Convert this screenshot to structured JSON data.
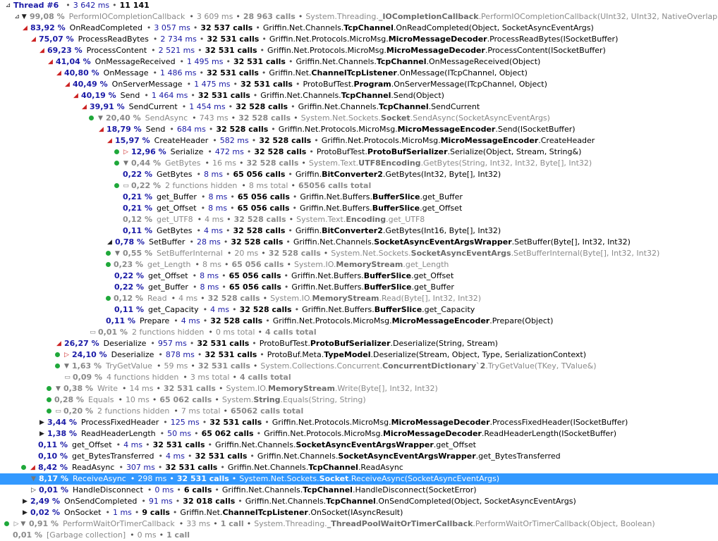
{
  "colors": {
    "selection": "#3399ff",
    "percent": "#1a1aa6",
    "dot": "#1fa83a",
    "toggle_red": "#cc2222"
  },
  "rows": [
    {
      "indent": 0,
      "dot": false,
      "toggle": "⊿",
      "tcolor": "blk",
      "pct": "Thread #6",
      "name": "",
      "ms": "3 642 ms",
      "calls": "11 141",
      "ns": "",
      "cls": "",
      "sig": "",
      "dim": false
    },
    {
      "indent": 1,
      "dot": false,
      "toggle": "⊿ ▼",
      "tcolor": "blk",
      "pct": "99,08 %",
      "name": "PerformIOCompletionCallback",
      "ms": "3 609 ms",
      "calls": "28 963 calls",
      "ns": "System.Threading.",
      "cls": "_IOCompletionCallback",
      "sig": ".PerformIOCompletionCallback(UInt32, UInt32, NativeOverlapped*)",
      "dim": true
    },
    {
      "indent": 2,
      "dot": false,
      "toggle": "◢",
      "tcolor": "red",
      "pct": "83,92 %",
      "name": "OnReadCompleted",
      "ms": "3 057 ms",
      "calls": "32 537 calls",
      "ns": "Griffin.Net.Channels.",
      "cls": "TcpChannel",
      "sig": ".OnReadCompleted(Object, SocketAsyncEventArgs)",
      "dim": false
    },
    {
      "indent": 3,
      "dot": false,
      "toggle": "◢",
      "tcolor": "red",
      "pct": "75,07 %",
      "name": "ProcessReadBytes",
      "ms": "2 734 ms",
      "calls": "32 531 calls",
      "ns": "Griffin.Net.Protocols.MicroMsg.",
      "cls": "MicroMessageDecoder",
      "sig": ".ProcessReadBytes(ISocketBuffer)",
      "dim": false
    },
    {
      "indent": 4,
      "dot": false,
      "toggle": "◢",
      "tcolor": "red",
      "pct": "69,23 %",
      "name": "ProcessContent",
      "ms": "2 521 ms",
      "calls": "32 531 calls",
      "ns": "Griffin.Net.Protocols.MicroMsg.",
      "cls": "MicroMessageDecoder",
      "sig": ".ProcessContent(ISocketBuffer)",
      "dim": false
    },
    {
      "indent": 5,
      "dot": false,
      "toggle": "◢",
      "tcolor": "red",
      "pct": "41,04 %",
      "name": "OnMessageReceived",
      "ms": "1 495 ms",
      "calls": "32 531 calls",
      "ns": "Griffin.Net.Channels.",
      "cls": "TcpChannel",
      "sig": ".OnMessageReceived(Object)",
      "dim": false
    },
    {
      "indent": 6,
      "dot": false,
      "toggle": "◢",
      "tcolor": "red",
      "pct": "40,80 %",
      "name": "OnMessage",
      "ms": "1 486 ms",
      "calls": "32 531 calls",
      "ns": "Griffin.Net.",
      "cls": "ChannelTcpListener",
      "sig": ".OnMessage(ITcpChannel, Object)",
      "dim": false
    },
    {
      "indent": 7,
      "dot": false,
      "toggle": "◢",
      "tcolor": "red",
      "pct": "40,49 %",
      "name": "OnServerMessage",
      "ms": "1 475 ms",
      "calls": "32 531 calls",
      "ns": "ProtoBufTest.",
      "cls": "Program",
      "sig": ".OnServerMessage(ITcpChannel, Object)",
      "dim": false
    },
    {
      "indent": 8,
      "dot": false,
      "toggle": "◢",
      "tcolor": "red",
      "pct": "40,19 %",
      "name": "Send",
      "ms": "1 464 ms",
      "calls": "32 531 calls",
      "ns": "Griffin.Net.Channels.",
      "cls": "TcpChannel",
      "sig": ".Send(Object)",
      "dim": false
    },
    {
      "indent": 9,
      "dot": false,
      "toggle": "◢",
      "tcolor": "red",
      "pct": "39,91 %",
      "name": "SendCurrent",
      "ms": "1 454 ms",
      "calls": "32 528 calls",
      "ns": "Griffin.Net.Channels.",
      "cls": "TcpChannel",
      "sig": ".SendCurrent",
      "dim": false
    },
    {
      "indent": 10,
      "dot": true,
      "toggle": "▼",
      "tcolor": "gray",
      "pct": "20,40 %",
      "name": "SendAsync",
      "ms": "743 ms",
      "calls": "32 528 calls",
      "ns": "System.Net.Sockets.",
      "cls": "Socket",
      "sig": ".SendAsync(SocketAsyncEventArgs)",
      "dim": true
    },
    {
      "indent": 11,
      "dot": false,
      "toggle": "◢",
      "tcolor": "red",
      "pct": "18,79 %",
      "name": "Send",
      "ms": "684 ms",
      "calls": "32 528 calls",
      "ns": "Griffin.Net.Protocols.MicroMsg.",
      "cls": "MicroMessageEncoder",
      "sig": ".Send(ISocketBuffer)",
      "dim": false
    },
    {
      "indent": 12,
      "dot": false,
      "toggle": "◢",
      "tcolor": "red",
      "pct": "15,97 %",
      "name": "CreateHeader",
      "ms": "582 ms",
      "calls": "32 528 calls",
      "ns": "Griffin.Net.Protocols.MicroMsg.",
      "cls": "MicroMessageEncoder",
      "sig": ".CreateHeader",
      "dim": false
    },
    {
      "indent": 13,
      "dot": true,
      "toggle": "▷",
      "tcolor": "red",
      "pct": "12,96 %",
      "name": "Serialize",
      "ms": "472 ms",
      "calls": "32 528 calls",
      "ns": "ProtoBufTest.",
      "cls": "ProtoBufSerializer",
      "sig": ".Serialize(Object, Stream, String&)",
      "dim": false
    },
    {
      "indent": 13,
      "dot": true,
      "toggle": "▼",
      "tcolor": "gray",
      "pct": "0,44 %",
      "name": "GetBytes",
      "ms": "16 ms",
      "calls": "32 528 calls",
      "ns": "System.Text.",
      "cls": "UTF8Encoding",
      "sig": ".GetBytes(String, Int32, Int32, Byte[], Int32)",
      "dim": true
    },
    {
      "indent": 14,
      "dot": false,
      "toggle": "",
      "tcolor": "gray",
      "pct": "0,22 %",
      "name": "GetBytes",
      "ms": "8 ms",
      "calls": "65 056 calls",
      "ns": "Griffin.",
      "cls": "BitConverter2",
      "sig": ".GetBytes(Int32, Byte[], Int32)",
      "dim": false
    },
    {
      "indent": 13,
      "dot": true,
      "toggle": "▭",
      "tcolor": "gray",
      "pct": "0,22 %",
      "name": "2 functions hidden",
      "ms": "8 ms total",
      "calls": "65056 calls total",
      "ns": "",
      "cls": "",
      "sig": "",
      "dim": true,
      "hidden": true
    },
    {
      "indent": 14,
      "dot": false,
      "toggle": "",
      "tcolor": "gray",
      "pct": "0,21 %",
      "name": "get_Buffer",
      "ms": "8 ms",
      "calls": "65 056 calls",
      "ns": "Griffin.Net.Buffers.",
      "cls": "BufferSlice",
      "sig": ".get_Buffer",
      "dim": false
    },
    {
      "indent": 14,
      "dot": false,
      "toggle": "",
      "tcolor": "gray",
      "pct": "0,21 %",
      "name": "get_Offset",
      "ms": "8 ms",
      "calls": "65 056 calls",
      "ns": "Griffin.Net.Buffers.",
      "cls": "BufferSlice",
      "sig": ".get_Offset",
      "dim": false
    },
    {
      "indent": 14,
      "dot": false,
      "toggle": "",
      "tcolor": "gray",
      "pct": "0,12 %",
      "name": "get_UTF8",
      "ms": "4 ms",
      "calls": "32 528 calls",
      "ns": "System.Text.",
      "cls": "Encoding",
      "sig": ".get_UTF8",
      "dim": true
    },
    {
      "indent": 14,
      "dot": false,
      "toggle": "",
      "tcolor": "gray",
      "pct": "0,11 %",
      "name": "GetBytes",
      "ms": "4 ms",
      "calls": "32 528 calls",
      "ns": "Griffin.",
      "cls": "BitConverter2",
      "sig": ".GetBytes(Int16, Byte[], Int32)",
      "dim": false
    },
    {
      "indent": 12,
      "dot": false,
      "toggle": "◢",
      "tcolor": "blk",
      "pct": "0,78 %",
      "name": "SetBuffer",
      "ms": "28 ms",
      "calls": "32 528 calls",
      "ns": "Griffin.Net.Channels.",
      "cls": "SocketAsyncEventArgsWrapper",
      "sig": ".SetBuffer(Byte[], Int32, Int32)",
      "dim": false
    },
    {
      "indent": 12,
      "dot": true,
      "toggle": "▼",
      "tcolor": "gray",
      "pct": "0,55 %",
      "name": "SetBufferInternal",
      "ms": "20 ms",
      "calls": "32 528 calls",
      "ns": "System.Net.Sockets.",
      "cls": "SocketAsyncEventArgs",
      "sig": ".SetBufferInternal(Byte[], Int32, Int32)",
      "dim": true
    },
    {
      "indent": 12,
      "dot": true,
      "toggle": "",
      "tcolor": "gray",
      "pct": "0,23 %",
      "name": "get_Length",
      "ms": "8 ms",
      "calls": "65 056 calls",
      "ns": "System.IO.",
      "cls": "MemoryStream",
      "sig": ".get_Length",
      "dim": true
    },
    {
      "indent": 13,
      "dot": false,
      "toggle": "",
      "tcolor": "gray",
      "pct": "0,22 %",
      "name": "get_Offset",
      "ms": "8 ms",
      "calls": "65 056 calls",
      "ns": "Griffin.Net.Buffers.",
      "cls": "BufferSlice",
      "sig": ".get_Offset",
      "dim": false
    },
    {
      "indent": 13,
      "dot": false,
      "toggle": "",
      "tcolor": "gray",
      "pct": "0,22 %",
      "name": "get_Buffer",
      "ms": "8 ms",
      "calls": "65 056 calls",
      "ns": "Griffin.Net.Buffers.",
      "cls": "BufferSlice",
      "sig": ".get_Buffer",
      "dim": false
    },
    {
      "indent": 12,
      "dot": true,
      "toggle": "",
      "tcolor": "gray",
      "pct": "0,12 %",
      "name": "Read",
      "ms": "4 ms",
      "calls": "32 528 calls",
      "ns": "System.IO.",
      "cls": "MemoryStream",
      "sig": ".Read(Byte[], Int32, Int32)",
      "dim": true
    },
    {
      "indent": 13,
      "dot": false,
      "toggle": "",
      "tcolor": "gray",
      "pct": "0,11 %",
      "name": "get_Capacity",
      "ms": "4 ms",
      "calls": "32 528 calls",
      "ns": "Griffin.Net.Buffers.",
      "cls": "BufferSlice",
      "sig": ".get_Capacity",
      "dim": false
    },
    {
      "indent": 12,
      "dot": false,
      "toggle": "",
      "tcolor": "gray",
      "pct": "0,11 %",
      "name": "Prepare",
      "ms": "4 ms",
      "calls": "32 528 calls",
      "ns": "Griffin.Net.Protocols.MicroMsg.",
      "cls": "MicroMessageEncoder",
      "sig": ".Prepare(Object)",
      "dim": false
    },
    {
      "indent": 10,
      "dot": false,
      "toggle": "▭",
      "tcolor": "gray",
      "pct": "0,01 %",
      "name": "2 functions hidden",
      "ms": "0 ms total",
      "calls": "4 calls total",
      "ns": "",
      "cls": "",
      "sig": "",
      "dim": true,
      "hidden": true
    },
    {
      "indent": 6,
      "dot": false,
      "toggle": "◢",
      "tcolor": "red",
      "pct": "26,27 %",
      "name": "Deserialize",
      "ms": "957 ms",
      "calls": "32 531 calls",
      "ns": "ProtoBufTest.",
      "cls": "ProtoBufSerializer",
      "sig": ".Deserialize(String, Stream)",
      "dim": false
    },
    {
      "indent": 6,
      "dot": true,
      "toggle": "▷",
      "tcolor": "red",
      "pct": "24,10 %",
      "name": "Deserialize",
      "ms": "878 ms",
      "calls": "32 531 calls",
      "ns": "ProtoBuf.Meta.",
      "cls": "TypeModel",
      "sig": ".Deserialize(Stream, Object, Type, SerializationContext)",
      "dim": false
    },
    {
      "indent": 6,
      "dot": true,
      "toggle": "▼",
      "tcolor": "gray",
      "pct": "1,63 %",
      "name": "TryGetValue",
      "ms": "59 ms",
      "calls": "32 531 calls",
      "ns": "System.Collections.Concurrent.",
      "cls": "ConcurrentDictionary`2",
      "sig": ".TryGetValue(TKey, TValue&)",
      "dim": true
    },
    {
      "indent": 7,
      "dot": false,
      "toggle": "▭",
      "tcolor": "gray",
      "pct": "0,09 %",
      "name": "4 functions hidden",
      "ms": "3 ms total",
      "calls": "4 calls total",
      "ns": "",
      "cls": "",
      "sig": "",
      "dim": true,
      "hidden": true
    },
    {
      "indent": 5,
      "dot": true,
      "toggle": "▼",
      "tcolor": "gray",
      "pct": "0,38 %",
      "name": "Write",
      "ms": "14 ms",
      "calls": "32 531 calls",
      "ns": "System.IO.",
      "cls": "MemoryStream",
      "sig": ".Write(Byte[], Int32, Int32)",
      "dim": true
    },
    {
      "indent": 5,
      "dot": true,
      "toggle": "",
      "tcolor": "gray",
      "pct": "0,28 %",
      "name": "Equals",
      "ms": "10 ms",
      "calls": "65 062 calls",
      "ns": "System.",
      "cls": "String",
      "sig": ".Equals(String, String)",
      "dim": true
    },
    {
      "indent": 5,
      "dot": true,
      "toggle": "▭",
      "tcolor": "gray",
      "pct": "0,20 %",
      "name": "2 functions hidden",
      "ms": "7 ms total",
      "calls": "65062 calls total",
      "ns": "",
      "cls": "",
      "sig": "",
      "dim": true,
      "hidden": true
    },
    {
      "indent": 4,
      "dot": false,
      "toggle": "▶",
      "tcolor": "blk",
      "pct": "3,44 %",
      "name": "ProcessFixedHeader",
      "ms": "125 ms",
      "calls": "32 531 calls",
      "ns": "Griffin.Net.Protocols.MicroMsg.",
      "cls": "MicroMessageDecoder",
      "sig": ".ProcessFixedHeader(ISocketBuffer)",
      "dim": false
    },
    {
      "indent": 4,
      "dot": false,
      "toggle": "▶",
      "tcolor": "blk",
      "pct": "1,38 %",
      "name": "ReadHeaderLength",
      "ms": "50 ms",
      "calls": "65 062 calls",
      "ns": "Griffin.Net.Protocols.MicroMsg.",
      "cls": "MicroMessageDecoder",
      "sig": ".ReadHeaderLength(ISocketBuffer)",
      "dim": false
    },
    {
      "indent": 4,
      "dot": false,
      "toggle": "",
      "tcolor": "gray",
      "pct": "0,11 %",
      "name": "get_Offset",
      "ms": "4 ms",
      "calls": "32 531 calls",
      "ns": "Griffin.Net.Channels.",
      "cls": "SocketAsyncEventArgsWrapper",
      "sig": ".get_Offset",
      "dim": false
    },
    {
      "indent": 4,
      "dot": false,
      "toggle": "",
      "tcolor": "gray",
      "pct": "0,10 %",
      "name": "get_BytesTransferred",
      "ms": "4 ms",
      "calls": "32 531 calls",
      "ns": "Griffin.Net.Channels.",
      "cls": "SocketAsyncEventArgsWrapper",
      "sig": ".get_BytesTransferred",
      "dim": false
    },
    {
      "indent": 2,
      "dot": true,
      "toggle": "◢",
      "tcolor": "red",
      "pct": "8,42 %",
      "name": "ReadAsync",
      "ms": "307 ms",
      "calls": "32 531 calls",
      "ns": "Griffin.Net.Channels.",
      "cls": "TcpChannel",
      "sig": ".ReadAsync",
      "dim": false
    },
    {
      "indent": 3,
      "dot": false,
      "toggle": "▼",
      "tcolor": "gray",
      "pct": "8,17 %",
      "name": "ReceiveAsync",
      "ms": "298 ms",
      "calls": "32 531 calls",
      "ns": "System.Net.Sockets.",
      "cls": "Socket",
      "sig": ".ReceiveAsync(SocketAsyncEventArgs)",
      "dim": false,
      "selected": true
    },
    {
      "indent": 3,
      "dot": false,
      "toggle": "▷",
      "tcolor": "blk",
      "pct": "0,01 %",
      "name": "HandleDisconnect",
      "ms": "0 ms",
      "calls": "6 calls",
      "ns": "Griffin.Net.Channels.",
      "cls": "TcpChannel",
      "sig": ".HandleDisconnect(SocketError)",
      "dim": false
    },
    {
      "indent": 2,
      "dot": false,
      "toggle": "▶",
      "tcolor": "blk",
      "pct": "2,49 %",
      "name": "OnSendCompleted",
      "ms": "91 ms",
      "calls": "32 018 calls",
      "ns": "Griffin.Net.Channels.",
      "cls": "TcpChannel",
      "sig": ".OnSendCompleted(Object, SocketAsyncEventArgs)",
      "dim": false
    },
    {
      "indent": 2,
      "dot": false,
      "toggle": "▶",
      "tcolor": "blk",
      "pct": "0,02 %",
      "name": "OnSocket",
      "ms": "1 ms",
      "calls": "9 calls",
      "ns": "Griffin.Net.",
      "cls": "ChannelTcpListener",
      "sig": ".OnSocket(IAsyncResult)",
      "dim": false
    },
    {
      "indent": 0,
      "dot": true,
      "toggle": "▷ ▼",
      "tcolor": "gray",
      "pct": "0,91 %",
      "name": "PerformWaitOrTimerCallback",
      "ms": "33 ms",
      "calls": "1 call",
      "ns": "System.Threading.",
      "cls": "_ThreadPoolWaitOrTimerCallback",
      "sig": ".PerformWaitOrTimerCallback(Object, Boolean)",
      "dim": true
    },
    {
      "indent": 1,
      "dot": false,
      "toggle": "",
      "tcolor": "gray",
      "pct": "0,01 %",
      "name": "[Garbage collection]",
      "ms": "0 ms",
      "calls": "1 call",
      "ns": "",
      "cls": "",
      "sig": "",
      "dim": true
    }
  ]
}
